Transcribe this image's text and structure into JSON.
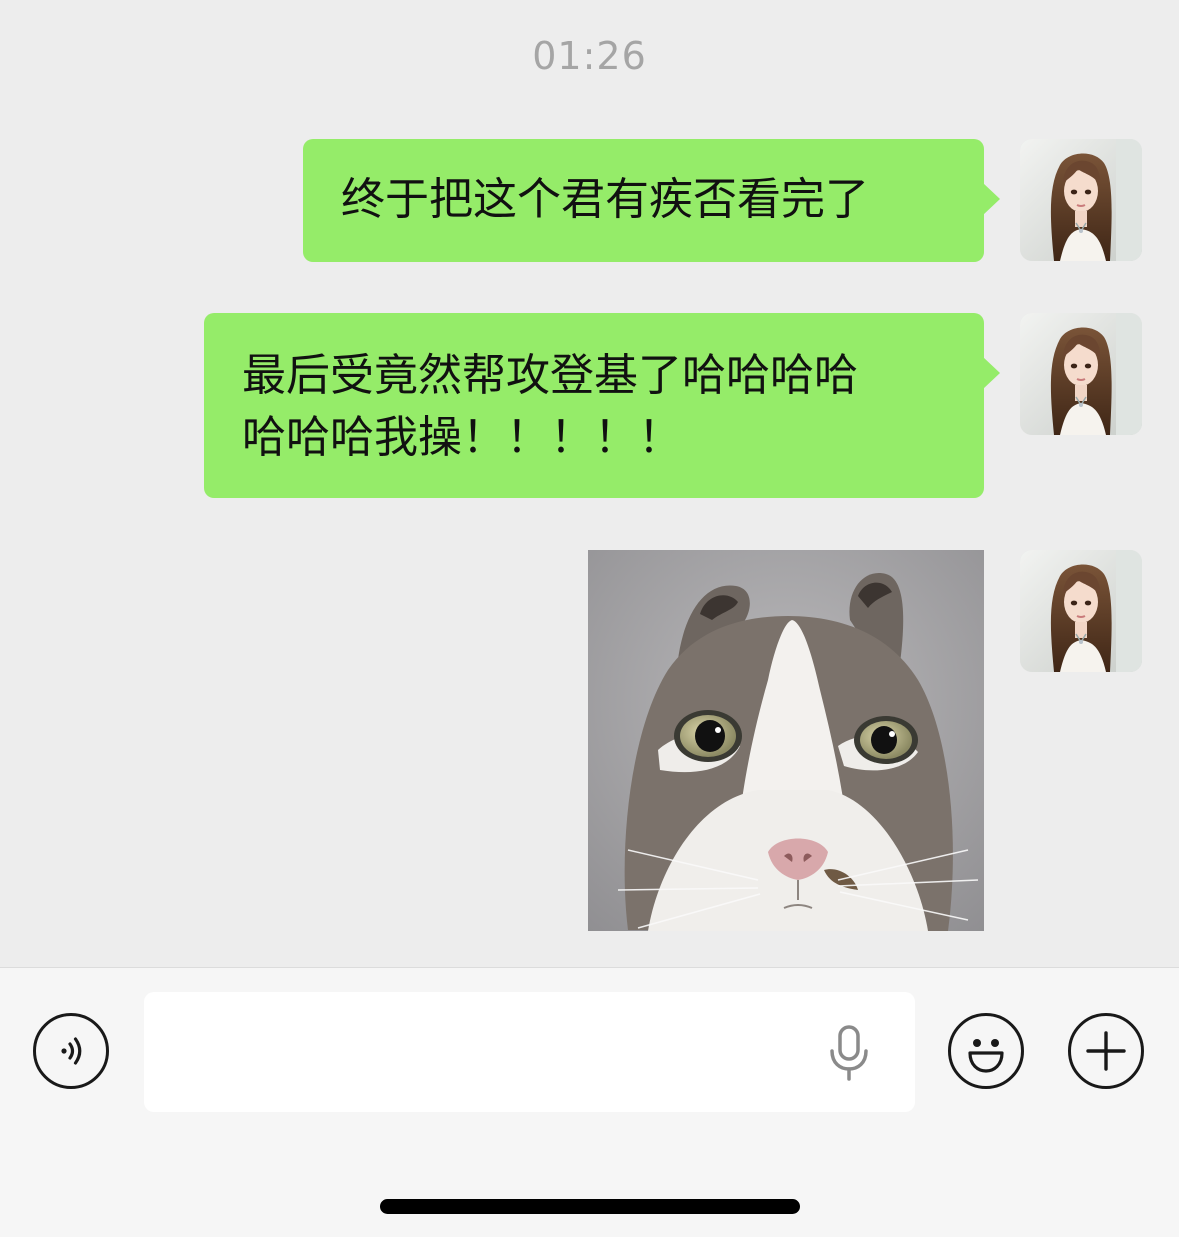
{
  "chat": {
    "timestamp": "01:26",
    "messages": [
      {
        "type": "text",
        "direction": "outgoing",
        "text": "终于把这个君有疾否看完了",
        "avatar_icon": "user-avatar-icon"
      },
      {
        "type": "text",
        "direction": "outgoing",
        "text": "最后受竟然帮攻登基了哈哈哈哈\n哈哈哈我操！！！！！",
        "avatar_icon": "user-avatar-icon"
      },
      {
        "type": "image",
        "direction": "outgoing",
        "image_subject": "cat-photo",
        "avatar_icon": "user-avatar-icon"
      }
    ]
  },
  "input_bar": {
    "voice_toggle_icon": "voice-wave-icon",
    "message_input_value": "",
    "mic_icon": "microphone-icon",
    "emoji_icon": "emoji-smile-icon",
    "more_icon": "plus-icon"
  },
  "colors": {
    "chat_background": "#ededed",
    "outgoing_bubble": "#95ec69",
    "timestamp_text": "#a5a5a5",
    "input_bar_background": "#f6f6f6",
    "icon_stroke": "#191919"
  }
}
